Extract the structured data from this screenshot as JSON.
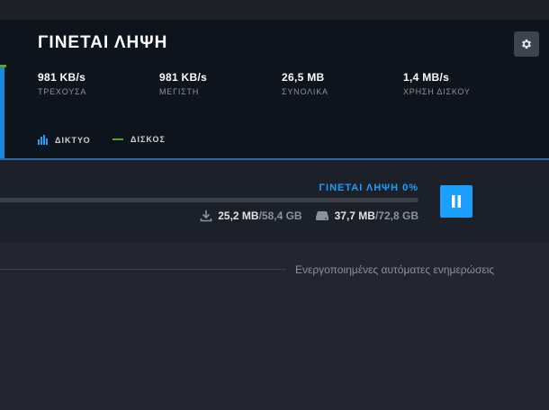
{
  "header": {
    "title": "ΓΙΝΕΤΑΙ ΛΗΨΗ",
    "settings_icon": "gear-icon"
  },
  "stats": [
    {
      "value": "981 KB/s",
      "label": "ΤΡΕΧΟΥΣΑ"
    },
    {
      "value": "981 KB/s",
      "label": "ΜΕΓΙΣΤΗ"
    },
    {
      "value": "26,5 MB",
      "label": "ΣΥΝΟΛΙΚΑ"
    },
    {
      "value": "1,4 MB/s",
      "label": "ΧΡΗΣΗ ΔΙΣΚΟΥ"
    }
  ],
  "legend": {
    "network_label": "ΔΙΚΤΥΟ",
    "disk_label": "ΔΙΣΚΟΣ",
    "network_color": "#1a9fff",
    "disk_color": "#5ba32b"
  },
  "download": {
    "status": "ΓΙΝΕΤΑΙ ΛΗΨΗ 0%",
    "progress_percent": 0,
    "downloaded": "25,2 MB",
    "download_total": "/58,4 GB",
    "disk_written": "37,7 MB",
    "disk_total": "/72,8 GB",
    "accent_color": "#1a9fff"
  },
  "footer": {
    "auto_updates_text": "Ενεργοποιημένες αυτόματες ενημερώσεις"
  }
}
